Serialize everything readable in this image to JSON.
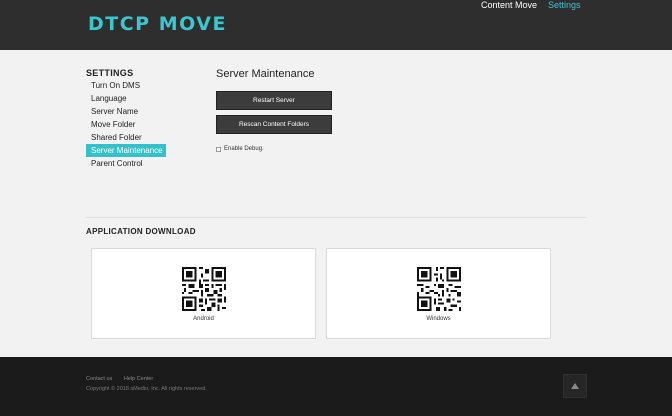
{
  "header": {
    "logo": "DTCP MOVE",
    "nav": [
      "Content Move",
      "Settings"
    ]
  },
  "sidebar": {
    "title": "SETTINGS",
    "items": [
      "Turn On DMS",
      "Language",
      "Server Name",
      "Move Folder",
      "Shared Folder",
      "Server Maintenance",
      "Parent Control"
    ],
    "active": "Server Maintenance"
  },
  "main": {
    "title": "Server Maintenance",
    "restart_label": "Restart Server",
    "rescan_label": "Rescan Content Folders",
    "debug_label": "Enable Debug."
  },
  "download": {
    "title": "APPLICATION DOWNLOAD",
    "apps": [
      "Android",
      "Windows"
    ]
  },
  "footer": {
    "links": [
      "Contact us",
      "Help Center"
    ],
    "copyright": "Copyright © 2018 sMedio, Inc. All rights reserved."
  },
  "colors": {
    "accent": "#35c1cb",
    "header_bg": "#2e2e2e",
    "footer_bg": "#1b1b1b",
    "button_bg": "#3c3c3c"
  },
  "icons": {
    "qr": "qr-code-icon",
    "scroll_top": "chevron-up-icon"
  }
}
